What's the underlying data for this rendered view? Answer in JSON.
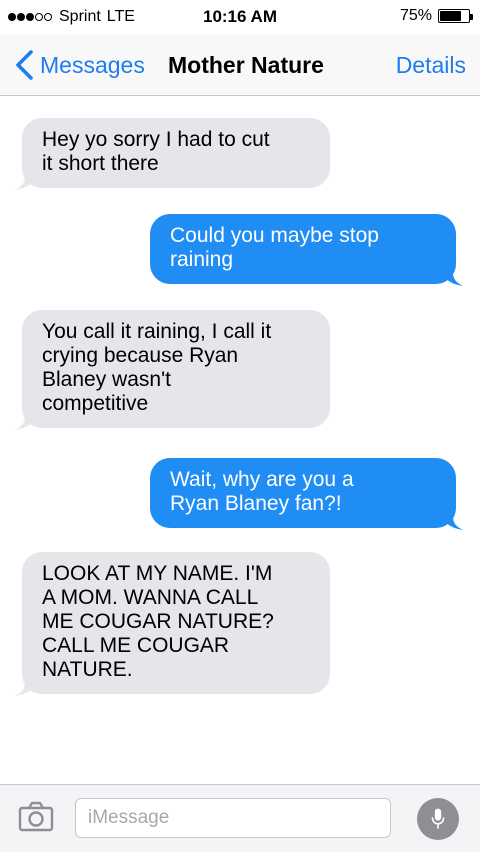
{
  "status_bar": {
    "carrier": "Sprint",
    "network": "LTE",
    "time": "10:16 AM",
    "battery_percent": "75%",
    "battery_level": 0.75,
    "signal_bars_filled": 3,
    "signal_bars_total": 5
  },
  "nav": {
    "back_label": "Messages",
    "title": "Mother Nature",
    "details_label": "Details"
  },
  "messages": [
    {
      "direction": "incoming",
      "lines": [
        "Hey yo sorry I had to cut",
        "it short there"
      ]
    },
    {
      "direction": "outgoing",
      "lines": [
        "Could you maybe stop",
        "raining"
      ]
    },
    {
      "direction": "incoming",
      "lines": [
        "You call it raining, I call it",
        "crying because Ryan",
        "Blaney wasn't",
        "competitive"
      ]
    },
    {
      "direction": "outgoing",
      "lines": [
        "Wait, why are you a",
        "Ryan Blaney fan?!"
      ]
    },
    {
      "direction": "incoming",
      "lines": [
        "LOOK AT MY NAME. I'M",
        "A MOM. WANNA CALL",
        "ME COUGAR NATURE?",
        "CALL ME COUGAR",
        "NATURE."
      ]
    }
  ],
  "input": {
    "placeholder": "iMessage"
  },
  "icons": {
    "back": "chevron-left-icon",
    "camera": "camera-icon",
    "mic": "microphone-icon"
  },
  "colors": {
    "accent": "#1e7cf3",
    "outgoing_bubble": "#1f8df4",
    "incoming_bubble": "#e5e5ea"
  }
}
